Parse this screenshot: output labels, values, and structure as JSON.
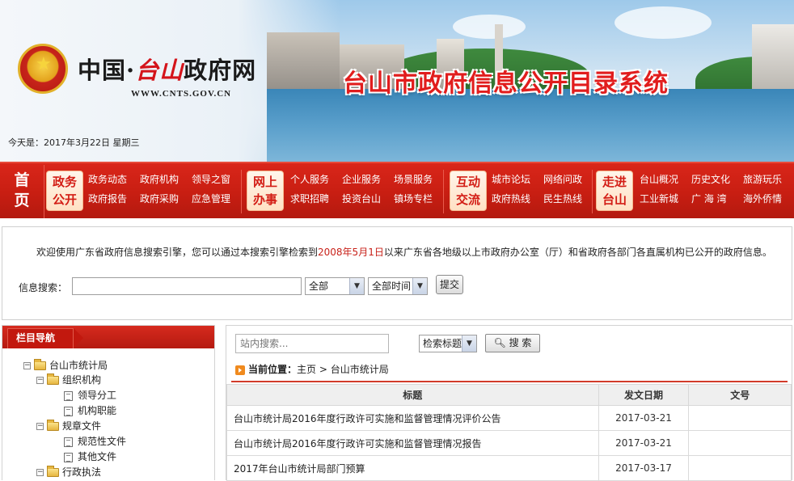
{
  "header": {
    "site_name_prefix": "中国·",
    "site_name_city": "台山",
    "site_name_suffix": "政府网",
    "domain": "WWW.CNTS.GOV.CN",
    "banner_title": "台山市政府信息公开目录系统",
    "today": "今天是：2017年3月22日  星期三"
  },
  "nav": {
    "home": [
      "首",
      "页"
    ],
    "groups": [
      {
        "badge": [
          "政务",
          "公开"
        ],
        "links": [
          [
            "政务动态",
            "政府机构",
            "领导之窗"
          ],
          [
            "政府报告",
            "政府采购",
            "应急管理"
          ]
        ]
      },
      {
        "badge": [
          "网上",
          "办事"
        ],
        "links": [
          [
            "个人服务",
            "企业服务",
            "场景服务"
          ],
          [
            "求职招聘",
            "投资台山",
            "镇场专栏"
          ]
        ]
      },
      {
        "badge": [
          "互动",
          "交流"
        ],
        "links": [
          [
            "城市论坛",
            "网络问政"
          ],
          [
            "政府热线",
            "民生热线"
          ]
        ]
      },
      {
        "badge": [
          "走进",
          "台山"
        ],
        "links": [
          [
            "台山概况",
            "历史文化",
            "旅游玩乐"
          ],
          [
            "工业新城",
            "广 海 湾",
            "海外侨情"
          ]
        ]
      }
    ]
  },
  "search": {
    "welcome_before": "欢迎使用广东省政府信息搜索引擎，您可以通过本搜索引擎检索到",
    "welcome_date": "2008年5月1日",
    "welcome_after": "以来广东省各地级以上市政府办公室（厅）和省政府各部门各直属机构已公开的政府信息。",
    "label": "信息搜索：",
    "input_value": "",
    "scope_selected": "全部",
    "time_selected": "全部时间",
    "submit_label": "提交"
  },
  "sidebar": {
    "title": "栏目导航",
    "tree": [
      {
        "label": "台山市统计局",
        "type": "folder",
        "level": 0
      },
      {
        "label": "组织机构",
        "type": "folder",
        "level": 1
      },
      {
        "label": "领导分工",
        "type": "page",
        "level": 2
      },
      {
        "label": "机构职能",
        "type": "page",
        "level": 2
      },
      {
        "label": "规章文件",
        "type": "folder",
        "level": 1
      },
      {
        "label": "规范性文件",
        "type": "page",
        "level": 2
      },
      {
        "label": "其他文件",
        "type": "page",
        "level": 2
      },
      {
        "label": "行政执法",
        "type": "folder",
        "level": 1
      }
    ]
  },
  "main": {
    "site_search_placeholder": "站内搜索...",
    "search_field_selected": "检索标题",
    "search_button": "搜 索",
    "breadcrumb_label": "当前位置：",
    "breadcrumb_home": "主页",
    "breadcrumb_sep": ">",
    "breadcrumb_current": "台山市统计局",
    "table": {
      "headers": [
        "标题",
        "发文日期",
        "文号"
      ],
      "rows": [
        [
          "台山市统计局2016年度行政许可实施和监督管理情况评价公告",
          "2017-03-21",
          ""
        ],
        [
          "台山市统计局2016年度行政许可实施和监督管理情况报告",
          "2017-03-21",
          ""
        ],
        [
          "2017年台山市统计局部门预算",
          "2017-03-17",
          ""
        ]
      ]
    }
  },
  "colors": {
    "nav_red": "#c81e12",
    "accent_red": "#d23b2a",
    "date_red": "#c8221a"
  }
}
